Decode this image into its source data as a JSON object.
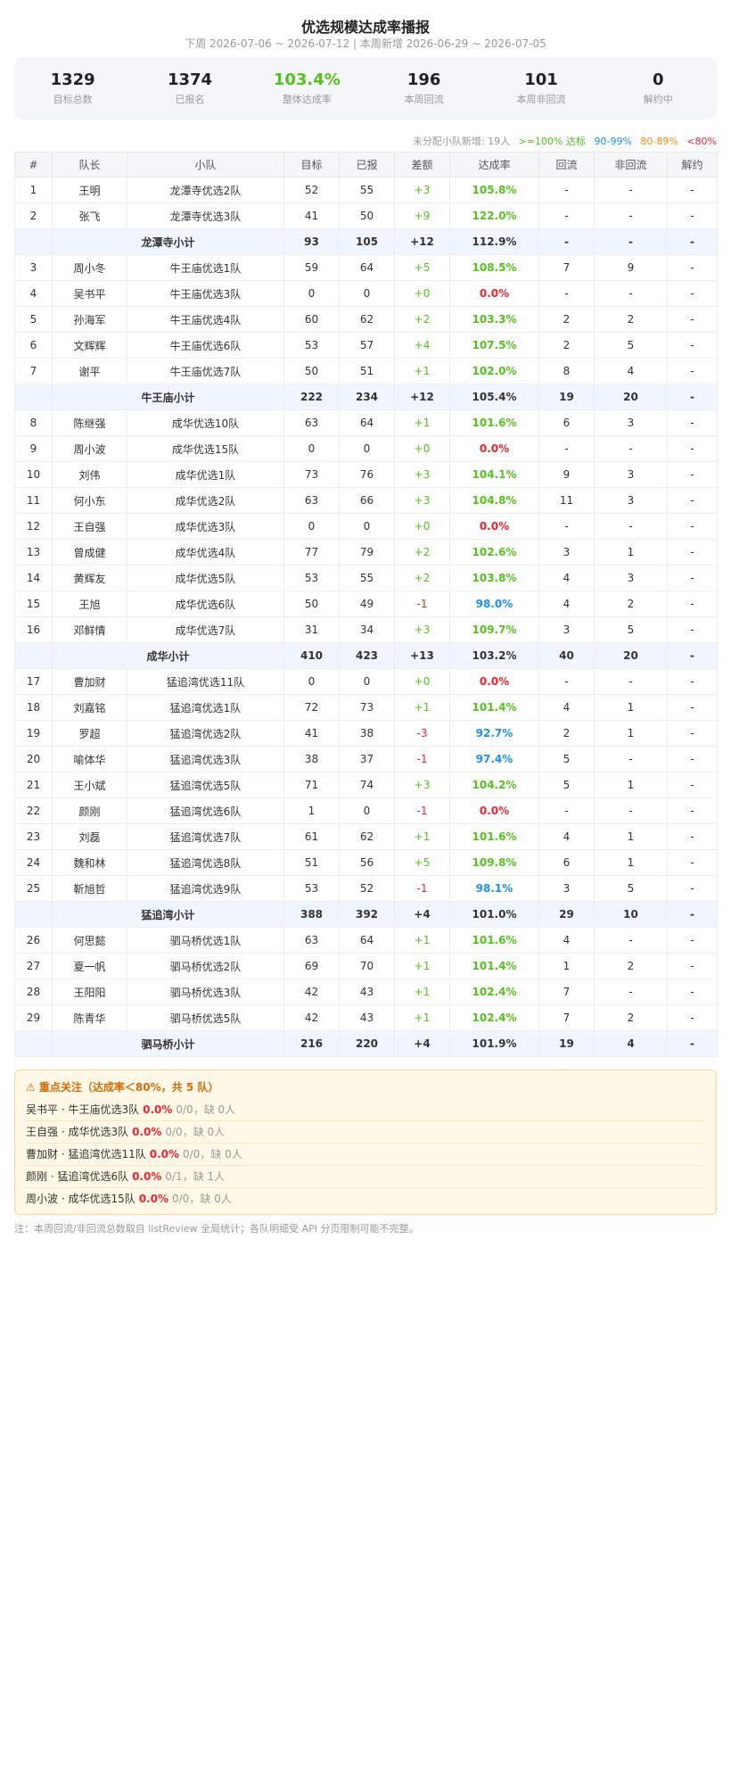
{
  "header": {
    "title": "优选规模达成率播报",
    "subtitle": "下周 2026-07-06 ~ 2026-07-12 | 本周新增 2026-06-29 ~ 2026-07-05"
  },
  "stats": [
    {
      "value": "1329",
      "label": "目标总数"
    },
    {
      "value": "1374",
      "label": "已报名"
    },
    {
      "value": "103.4%",
      "label": "整体达成率"
    },
    {
      "value": "196",
      "label": "本周回流"
    },
    {
      "value": "101",
      "label": "本周非回流"
    },
    {
      "value": "0",
      "label": "解约中"
    }
  ],
  "legend": {
    "unassigned": "未分配小队新增: 19人",
    "green": ">=100% 达标",
    "blue": "90-99%",
    "orange": "80-89%",
    "red": "<80%"
  },
  "colors": {
    "green": "#52c41a",
    "blue": "#1890ff",
    "orange": "#fa8c16",
    "red": "#f5222d"
  },
  "table": {
    "headers": [
      "#",
      "队长",
      "小队",
      "目标",
      "已报",
      "差额",
      "达成率",
      "回流",
      "非回流",
      "解约"
    ],
    "rows": [
      {
        "type": "row",
        "cells": [
          "1",
          "王明",
          "龙潭寺优选2队",
          "52",
          "55",
          "+3",
          "105.8%",
          "-",
          "-",
          "-"
        ],
        "diff": "pos",
        "rate": "green"
      },
      {
        "type": "row",
        "cells": [
          "2",
          "张飞",
          "龙潭寺优选3队",
          "41",
          "50",
          "+9",
          "122.0%",
          "-",
          "-",
          "-"
        ],
        "diff": "pos",
        "rate": "green"
      },
      {
        "type": "subtotal",
        "cells": [
          "",
          "龙潭寺小计",
          "93",
          "105",
          "+12",
          "112.9%",
          "-",
          "-",
          "-"
        ],
        "diff": "pos",
        "rate": "green"
      },
      {
        "type": "row",
        "cells": [
          "3",
          "周小冬",
          "牛王庙优选1队",
          "59",
          "64",
          "+5",
          "108.5%",
          "7",
          "9",
          "-"
        ],
        "diff": "pos",
        "rate": "green"
      },
      {
        "type": "row",
        "cells": [
          "4",
          "吴书平",
          "牛王庙优选3队",
          "0",
          "0",
          "+0",
          "0.0%",
          "-",
          "-",
          "-"
        ],
        "diff": "zero",
        "rate": "red"
      },
      {
        "type": "row",
        "cells": [
          "5",
          "孙海军",
          "牛王庙优选4队",
          "60",
          "62",
          "+2",
          "103.3%",
          "2",
          "2",
          "-"
        ],
        "diff": "pos",
        "rate": "green"
      },
      {
        "type": "row",
        "cells": [
          "6",
          "文辉辉",
          "牛王庙优选6队",
          "53",
          "57",
          "+4",
          "107.5%",
          "2",
          "5",
          "-"
        ],
        "diff": "pos",
        "rate": "green"
      },
      {
        "type": "row",
        "cells": [
          "7",
          "谢平",
          "牛王庙优选7队",
          "50",
          "51",
          "+1",
          "102.0%",
          "8",
          "4",
          "-"
        ],
        "diff": "pos",
        "rate": "green"
      },
      {
        "type": "subtotal",
        "cells": [
          "",
          "牛王庙小计",
          "222",
          "234",
          "+12",
          "105.4%",
          "19",
          "20",
          "-"
        ],
        "diff": "pos",
        "rate": "green"
      },
      {
        "type": "row",
        "cells": [
          "8",
          "陈继强",
          "成华优选10队",
          "63",
          "64",
          "+1",
          "101.6%",
          "6",
          "3",
          "-"
        ],
        "diff": "pos",
        "rate": "green"
      },
      {
        "type": "row",
        "cells": [
          "9",
          "周小波",
          "成华优选15队",
          "0",
          "0",
          "+0",
          "0.0%",
          "-",
          "-",
          "-"
        ],
        "diff": "zero",
        "rate": "red"
      },
      {
        "type": "row",
        "cells": [
          "10",
          "刘伟",
          "成华优选1队",
          "73",
          "76",
          "+3",
          "104.1%",
          "9",
          "3",
          "-"
        ],
        "diff": "pos",
        "rate": "green"
      },
      {
        "type": "row",
        "cells": [
          "11",
          "何小东",
          "成华优选2队",
          "63",
          "66",
          "+3",
          "104.8%",
          "11",
          "3",
          "-"
        ],
        "diff": "pos",
        "rate": "green"
      },
      {
        "type": "row",
        "cells": [
          "12",
          "王自强",
          "成华优选3队",
          "0",
          "0",
          "+0",
          "0.0%",
          "-",
          "-",
          "-"
        ],
        "diff": "zero",
        "rate": "red"
      },
      {
        "type": "row",
        "cells": [
          "13",
          "曾成健",
          "成华优选4队",
          "77",
          "79",
          "+2",
          "102.6%",
          "3",
          "1",
          "-"
        ],
        "diff": "pos",
        "rate": "green"
      },
      {
        "type": "row",
        "cells": [
          "14",
          "黄辉友",
          "成华优选5队",
          "53",
          "55",
          "+2",
          "103.8%",
          "4",
          "3",
          "-"
        ],
        "diff": "pos",
        "rate": "green"
      },
      {
        "type": "row",
        "cells": [
          "15",
          "王旭",
          "成华优选6队",
          "50",
          "49",
          "-1",
          "98.0%",
          "4",
          "2",
          "-"
        ],
        "diff": "neg",
        "rate": "blue"
      },
      {
        "type": "row",
        "cells": [
          "16",
          "邓鲜情",
          "成华优选7队",
          "31",
          "34",
          "+3",
          "109.7%",
          "3",
          "5",
          "-"
        ],
        "diff": "pos",
        "rate": "green"
      },
      {
        "type": "subtotal",
        "cells": [
          "",
          "成华小计",
          "410",
          "423",
          "+13",
          "103.2%",
          "40",
          "20",
          "-"
        ],
        "diff": "pos",
        "rate": "green"
      },
      {
        "type": "row",
        "cells": [
          "17",
          "曹加财",
          "猛追湾优选11队",
          "0",
          "0",
          "+0",
          "0.0%",
          "-",
          "-",
          "-"
        ],
        "diff": "zero",
        "rate": "red"
      },
      {
        "type": "row",
        "cells": [
          "18",
          "刘嘉铭",
          "猛追湾优选1队",
          "72",
          "73",
          "+1",
          "101.4%",
          "4",
          "1",
          "-"
        ],
        "diff": "pos",
        "rate": "green"
      },
      {
        "type": "row",
        "cells": [
          "19",
          "罗超",
          "猛追湾优选2队",
          "41",
          "38",
          "-3",
          "92.7%",
          "2",
          "1",
          "-"
        ],
        "diff": "neg",
        "rate": "blue"
      },
      {
        "type": "row",
        "cells": [
          "20",
          "喻体华",
          "猛追湾优选3队",
          "38",
          "37",
          "-1",
          "97.4%",
          "5",
          "-",
          "-"
        ],
        "diff": "neg",
        "rate": "blue"
      },
      {
        "type": "row",
        "cells": [
          "21",
          "王小斌",
          "猛追湾优选5队",
          "71",
          "74",
          "+3",
          "104.2%",
          "5",
          "1",
          "-"
        ],
        "diff": "pos",
        "rate": "green"
      },
      {
        "type": "row",
        "cells": [
          "22",
          "颜刚",
          "猛追湾优选6队",
          "1",
          "0",
          "-1",
          "0.0%",
          "-",
          "-",
          "-"
        ],
        "diff": "neg",
        "rate": "red"
      },
      {
        "type": "row",
        "cells": [
          "23",
          "刘磊",
          "猛追湾优选7队",
          "61",
          "62",
          "+1",
          "101.6%",
          "4",
          "1",
          "-"
        ],
        "diff": "pos",
        "rate": "green"
      },
      {
        "type": "row",
        "cells": [
          "24",
          "魏和林",
          "猛追湾优选8队",
          "51",
          "56",
          "+5",
          "109.8%",
          "6",
          "1",
          "-"
        ],
        "diff": "pos",
        "rate": "green"
      },
      {
        "type": "row",
        "cells": [
          "25",
          "靳旭哲",
          "猛追湾优选9队",
          "53",
          "52",
          "-1",
          "98.1%",
          "3",
          "5",
          "-"
        ],
        "diff": "neg",
        "rate": "blue"
      },
      {
        "type": "subtotal",
        "cells": [
          "",
          "猛追湾小计",
          "388",
          "392",
          "+4",
          "101.0%",
          "29",
          "10",
          "-"
        ],
        "diff": "pos",
        "rate": "green"
      },
      {
        "type": "row",
        "cells": [
          "26",
          "何思懿",
          "驷马桥优选1队",
          "63",
          "64",
          "+1",
          "101.6%",
          "4",
          "-",
          "-"
        ],
        "diff": "pos",
        "rate": "green"
      },
      {
        "type": "row",
        "cells": [
          "27",
          "夏一帆",
          "驷马桥优选2队",
          "69",
          "70",
          "+1",
          "101.4%",
          "1",
          "2",
          "-"
        ],
        "diff": "pos",
        "rate": "green"
      },
      {
        "type": "row",
        "cells": [
          "28",
          "王阳阳",
          "驷马桥优选3队",
          "42",
          "43",
          "+1",
          "102.4%",
          "7",
          "-",
          "-"
        ],
        "diff": "pos",
        "rate": "green"
      },
      {
        "type": "row",
        "cells": [
          "29",
          "陈青华",
          "驷马桥优选5队",
          "42",
          "43",
          "+1",
          "102.4%",
          "7",
          "2",
          "-"
        ],
        "diff": "pos",
        "rate": "green"
      },
      {
        "type": "subtotal",
        "cells": [
          "",
          "驷马桥小计",
          "216",
          "220",
          "+4",
          "101.9%",
          "19",
          "4",
          "-"
        ],
        "diff": "pos",
        "rate": "green"
      }
    ]
  },
  "alert": {
    "icon": "warning-icon",
    "title": "⚠ 重点关注（达成率＜80%，共 5 队）",
    "items": [
      {
        "name": "吴书平 · 牛王庙优选3队",
        "rate": "0.0%",
        "detail": "0/0，缺 0人"
      },
      {
        "name": "王自强 · 成华优选3队",
        "rate": "0.0%",
        "detail": "0/0，缺 0人"
      },
      {
        "name": "曹加财 · 猛追湾优选11队",
        "rate": "0.0%",
        "detail": "0/0，缺 0人"
      },
      {
        "name": "颜刚 · 猛追湾优选6队",
        "rate": "0.0%",
        "detail": "0/1，缺 1人"
      },
      {
        "name": "周小波 · 成华优选15队",
        "rate": "0.0%",
        "detail": "0/0，缺 0人"
      }
    ]
  },
  "note": "注：本周回流/非回流总数取自 listReview 全局统计；各队明细受 API 分页限制可能不完整。"
}
